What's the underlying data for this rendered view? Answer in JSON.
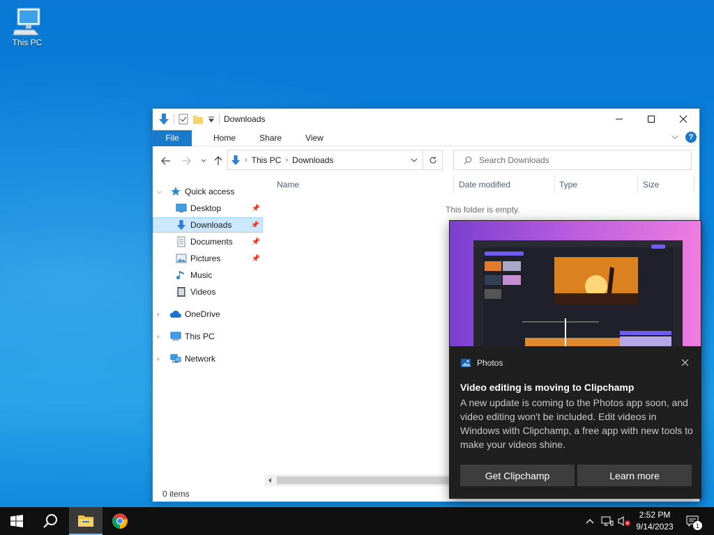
{
  "desktop": {
    "icons": [
      {
        "label": "This PC",
        "icon": "computer-icon"
      }
    ]
  },
  "explorer": {
    "title": "Downloads",
    "ribbon": {
      "file": "File",
      "tabs": [
        "Home",
        "Share",
        "View"
      ]
    },
    "address": {
      "crumbs": [
        "This PC",
        "Downloads"
      ]
    },
    "search": {
      "placeholder": "Search Downloads"
    },
    "nav": {
      "quick_access": "Quick access",
      "quick_items": [
        {
          "label": "Desktop",
          "icon": "desktop-icon",
          "pinned": true
        },
        {
          "label": "Downloads",
          "icon": "download-icon",
          "pinned": true,
          "selected": true
        },
        {
          "label": "Documents",
          "icon": "document-icon",
          "pinned": true
        },
        {
          "label": "Pictures",
          "icon": "picture-icon",
          "pinned": true
        },
        {
          "label": "Music",
          "icon": "music-icon",
          "pinned": false
        },
        {
          "label": "Videos",
          "icon": "video-icon",
          "pinned": false
        }
      ],
      "onedrive": "OneDrive",
      "this_pc": "This PC",
      "network": "Network"
    },
    "columns": [
      "Name",
      "Date modified",
      "Type",
      "Size"
    ],
    "empty_message": "This folder is empty.",
    "status": "0 items"
  },
  "toast": {
    "app": "Photos",
    "title": "Video editing is moving to Clipchamp",
    "body": "A new update is coming to the Photos app soon, and video editing won't be included. Edit videos in Windows with Clipchamp, a free app with new tools to make your videos shine.",
    "primary": "Get Clipchamp",
    "secondary": "Learn more"
  },
  "taskbar": {
    "time": "2:52 PM",
    "date": "9/14/2023",
    "notification_count": "1"
  },
  "colors": {
    "accent": "#1979ca",
    "selection": "#cce8ff",
    "toast_bg": "#1f1f1f",
    "taskbar_bg": "#101010"
  }
}
